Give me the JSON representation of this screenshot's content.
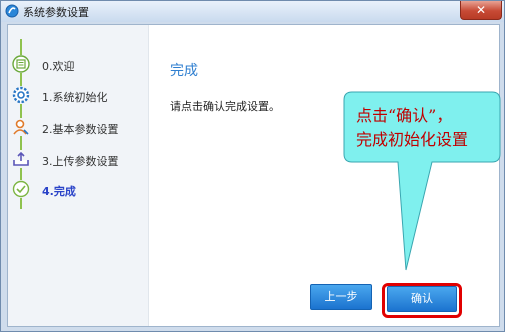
{
  "window": {
    "title": "系统参数设置",
    "close_label": "✕"
  },
  "steps": [
    {
      "label": "0.欢迎",
      "icon": "notes-icon",
      "active": false
    },
    {
      "label": "1.系统初始化",
      "icon": "gear-icon",
      "active": false
    },
    {
      "label": "2.基本参数设置",
      "icon": "user-icon",
      "active": false
    },
    {
      "label": "3.上传参数设置",
      "icon": "upload-tray-icon",
      "active": false
    },
    {
      "label": "4.完成",
      "icon": "check-circle-icon",
      "active": true
    }
  ],
  "main": {
    "title": "完成",
    "message": "请点击确认完成设置。",
    "prev_label": "上一步",
    "confirm_label": "确认"
  },
  "callout": {
    "line1": "点击“确认”，",
    "line2": "完成初始化设置"
  },
  "colors": {
    "accent": "#2f7fd0",
    "step_line": "#8fc24f",
    "callout_fill": "#7ff0ee",
    "highlight": "#e10000"
  }
}
